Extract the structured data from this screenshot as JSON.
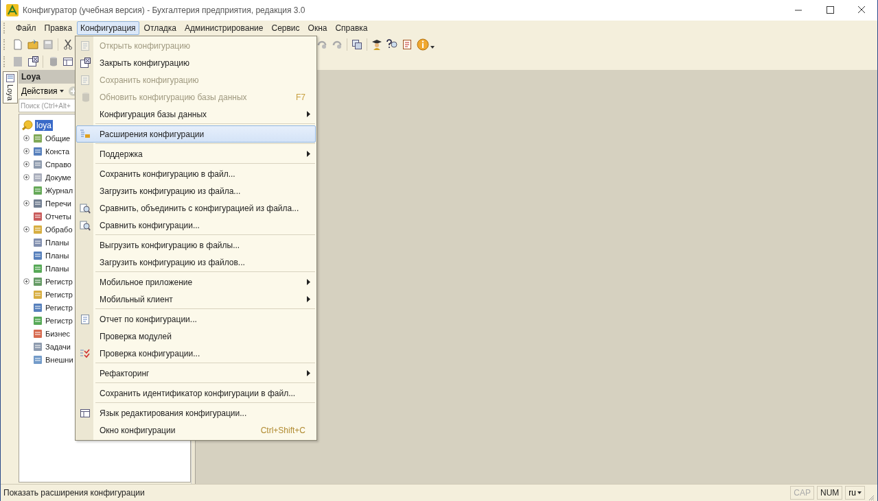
{
  "window": {
    "title": "Конфигуратор (учебная версия) - Бухгалтерия предприятия, редакция 3.0"
  },
  "menu_bar": [
    {
      "label": "Файл",
      "selected": false
    },
    {
      "label": "Правка",
      "selected": false
    },
    {
      "label": "Конфигурация",
      "selected": true
    },
    {
      "label": "Отладка",
      "selected": false
    },
    {
      "label": "Администрирование",
      "selected": false
    },
    {
      "label": "Сервис",
      "selected": false
    },
    {
      "label": "Окна",
      "selected": false
    },
    {
      "label": "Справка",
      "selected": false
    }
  ],
  "side_tab": {
    "label": "Loya",
    "selected": true
  },
  "panel": {
    "title": "Loya",
    "actions": "Действия",
    "search": {
      "placeholder": "Поиск (Ctrl+Alt+"
    }
  },
  "tree": {
    "label": "loya",
    "selected": true,
    "children": [
      {
        "label": "Общие",
        "expandable": true
      },
      {
        "label": "Конста",
        "expandable": true
      },
      {
        "label": "Справо",
        "expandable": true
      },
      {
        "label": "Докуме",
        "expandable": true
      },
      {
        "label": "Журнал",
        "expandable": false
      },
      {
        "label": "Перечи",
        "expandable": true
      },
      {
        "label": "Отчеты",
        "expandable": false
      },
      {
        "label": "Обрабо",
        "expandable": true
      },
      {
        "label": "Планы",
        "expandable": false
      },
      {
        "label": "Планы",
        "expandable": false
      },
      {
        "label": "Планы",
        "expandable": false
      },
      {
        "label": "Регистр",
        "expandable": true
      },
      {
        "label": "Регистр",
        "expandable": false
      },
      {
        "label": "Регистр",
        "expandable": false
      },
      {
        "label": "Регистр",
        "expandable": false
      },
      {
        "label": "Бизнес",
        "expandable": false
      },
      {
        "label": "Задачи",
        "expandable": false
      },
      {
        "label": "Внешни",
        "expandable": false
      }
    ]
  },
  "dropdown": [
    {
      "kind": "item",
      "label": "Открыть конфигурацию",
      "disabled": true,
      "selected": false
    },
    {
      "kind": "item",
      "label": "Закрыть конфигурацию",
      "disabled": false,
      "selected": false
    },
    {
      "kind": "item",
      "label": "Сохранить конфигурацию",
      "disabled": true,
      "selected": false
    },
    {
      "kind": "item",
      "label": "Обновить конфигурацию базы данных",
      "disabled": true,
      "selected": false,
      "shortcut": "F7"
    },
    {
      "kind": "item",
      "label": "Конфигурация базы данных",
      "disabled": false,
      "selected": false,
      "submenu": true
    },
    {
      "kind": "separator"
    },
    {
      "kind": "item",
      "label": "Расширения конфигурации",
      "disabled": false,
      "selected": true
    },
    {
      "kind": "separator"
    },
    {
      "kind": "item",
      "label": "Поддержка",
      "disabled": false,
      "selected": false,
      "submenu": true
    },
    {
      "kind": "separator"
    },
    {
      "kind": "item",
      "label": "Сохранить конфигурацию в файл...",
      "disabled": false,
      "selected": false
    },
    {
      "kind": "item",
      "label": "Загрузить конфигурацию из файла...",
      "disabled": false,
      "selected": false
    },
    {
      "kind": "item",
      "label": "Сравнить, объединить с конфигурацией из файла...",
      "disabled": false,
      "selected": false
    },
    {
      "kind": "item",
      "label": "Сравнить конфигурации...",
      "disabled": false,
      "selected": false
    },
    {
      "kind": "separator"
    },
    {
      "kind": "item",
      "label": "Выгрузить конфигурацию в файлы...",
      "disabled": false,
      "selected": false
    },
    {
      "kind": "item",
      "label": "Загрузить конфигурацию из файлов...",
      "disabled": false,
      "selected": false
    },
    {
      "kind": "separator"
    },
    {
      "kind": "item",
      "label": "Мобильное приложение",
      "disabled": false,
      "selected": false,
      "submenu": true
    },
    {
      "kind": "item",
      "label": "Мобильный клиент",
      "disabled": false,
      "selected": false,
      "submenu": true
    },
    {
      "kind": "separator"
    },
    {
      "kind": "item",
      "label": "Отчет по конфигурации...",
      "disabled": false,
      "selected": false
    },
    {
      "kind": "item",
      "label": "Проверка модулей",
      "disabled": false,
      "selected": false
    },
    {
      "kind": "item",
      "label": "Проверка конфигурации...",
      "disabled": false,
      "selected": false
    },
    {
      "kind": "separator"
    },
    {
      "kind": "item",
      "label": "Рефакторинг",
      "disabled": false,
      "selected": false,
      "submenu": true
    },
    {
      "kind": "separator"
    },
    {
      "kind": "item",
      "label": "Сохранить идентификатор конфигурации в файл...",
      "disabled": false,
      "selected": false
    },
    {
      "kind": "separator"
    },
    {
      "kind": "item",
      "label": "Язык редактирования конфигурации...",
      "disabled": false,
      "selected": false
    },
    {
      "kind": "item",
      "label": "Окно конфигурации",
      "disabled": false,
      "selected": false,
      "shortcut": "Ctrl+Shift+C"
    }
  ],
  "status_bar": {
    "message": "Показать расширения конфигурации",
    "indicators": [
      {
        "label": "CAP",
        "on": false
      },
      {
        "label": "NUM",
        "on": true
      }
    ],
    "language": "ru"
  }
}
